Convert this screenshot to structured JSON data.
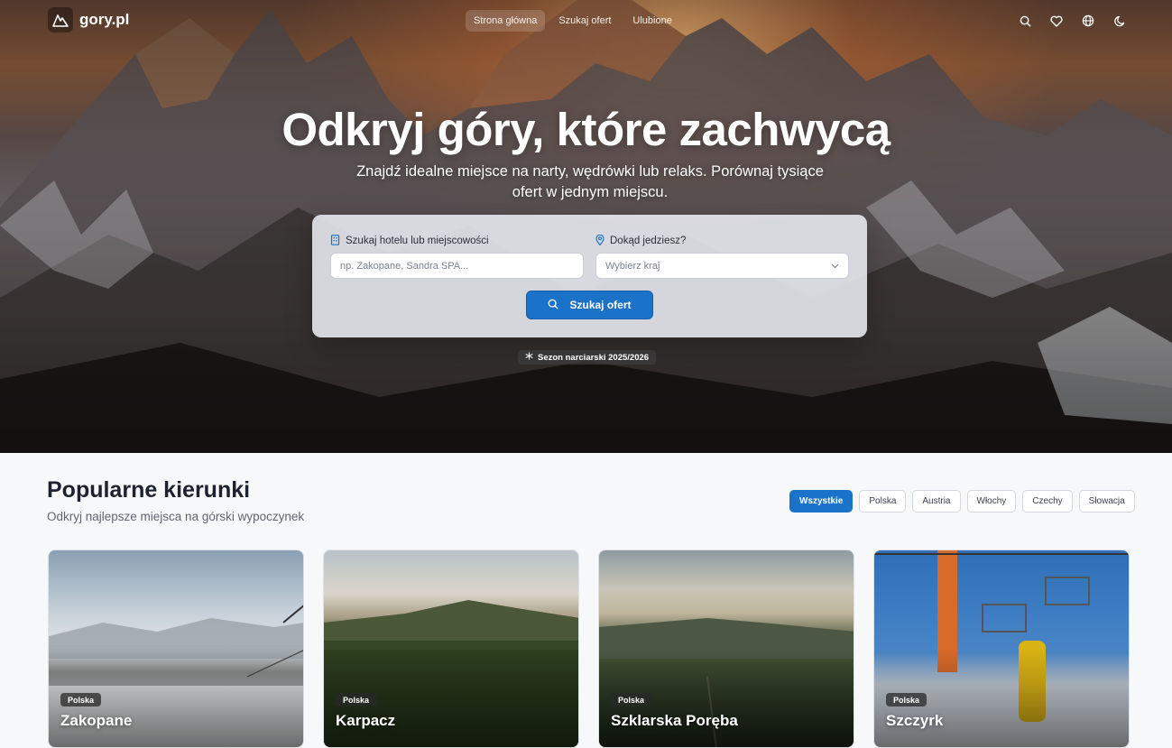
{
  "brand": {
    "name": "gory.pl",
    "icon": "mountain-logo-icon"
  },
  "nav": {
    "links": [
      {
        "label": "Strona główna",
        "active": true
      },
      {
        "label": "Szukaj ofert",
        "active": false
      },
      {
        "label": "Ulubione",
        "active": false
      }
    ],
    "icons": [
      "search-icon",
      "heart-icon",
      "globe-icon",
      "moon-icon"
    ]
  },
  "hero": {
    "title": "Odkryj góry, które zachwycą",
    "subtitle": "Znajdź idealne miejsce na narty, wędrówki lub relaks. Porównaj tysiące ofert w jednym miejscu.",
    "season_badge": "Sezon narciarski 2025/2026"
  },
  "search": {
    "hotel_label": "Szukaj hotelu lub miejscowości",
    "hotel_placeholder": "np. Zakopane, Sandra SPA...",
    "destination_label": "Dokąd jedziesz?",
    "destination_value": "Wybierz kraj",
    "button_label": "Szukaj ofert"
  },
  "popular": {
    "title": "Popularne kierunki",
    "subtitle": "Odkryj najlepsze miejsca na górski wypoczynek",
    "filters": [
      {
        "label": "Wszystkie",
        "active": true
      },
      {
        "label": "Polska",
        "active": false
      },
      {
        "label": "Austria",
        "active": false
      },
      {
        "label": "Włochy",
        "active": false
      },
      {
        "label": "Czechy",
        "active": false
      },
      {
        "label": "Słowacja",
        "active": false
      }
    ],
    "cards": [
      {
        "country": "Polska",
        "name": "Zakopane"
      },
      {
        "country": "Polska",
        "name": "Karpacz"
      },
      {
        "country": "Polska",
        "name": "Szklarska Poręba"
      },
      {
        "country": "Polska",
        "name": "Szczyrk"
      }
    ]
  },
  "colors": {
    "accent": "#1a73c8",
    "background": "#f7f8fa"
  }
}
